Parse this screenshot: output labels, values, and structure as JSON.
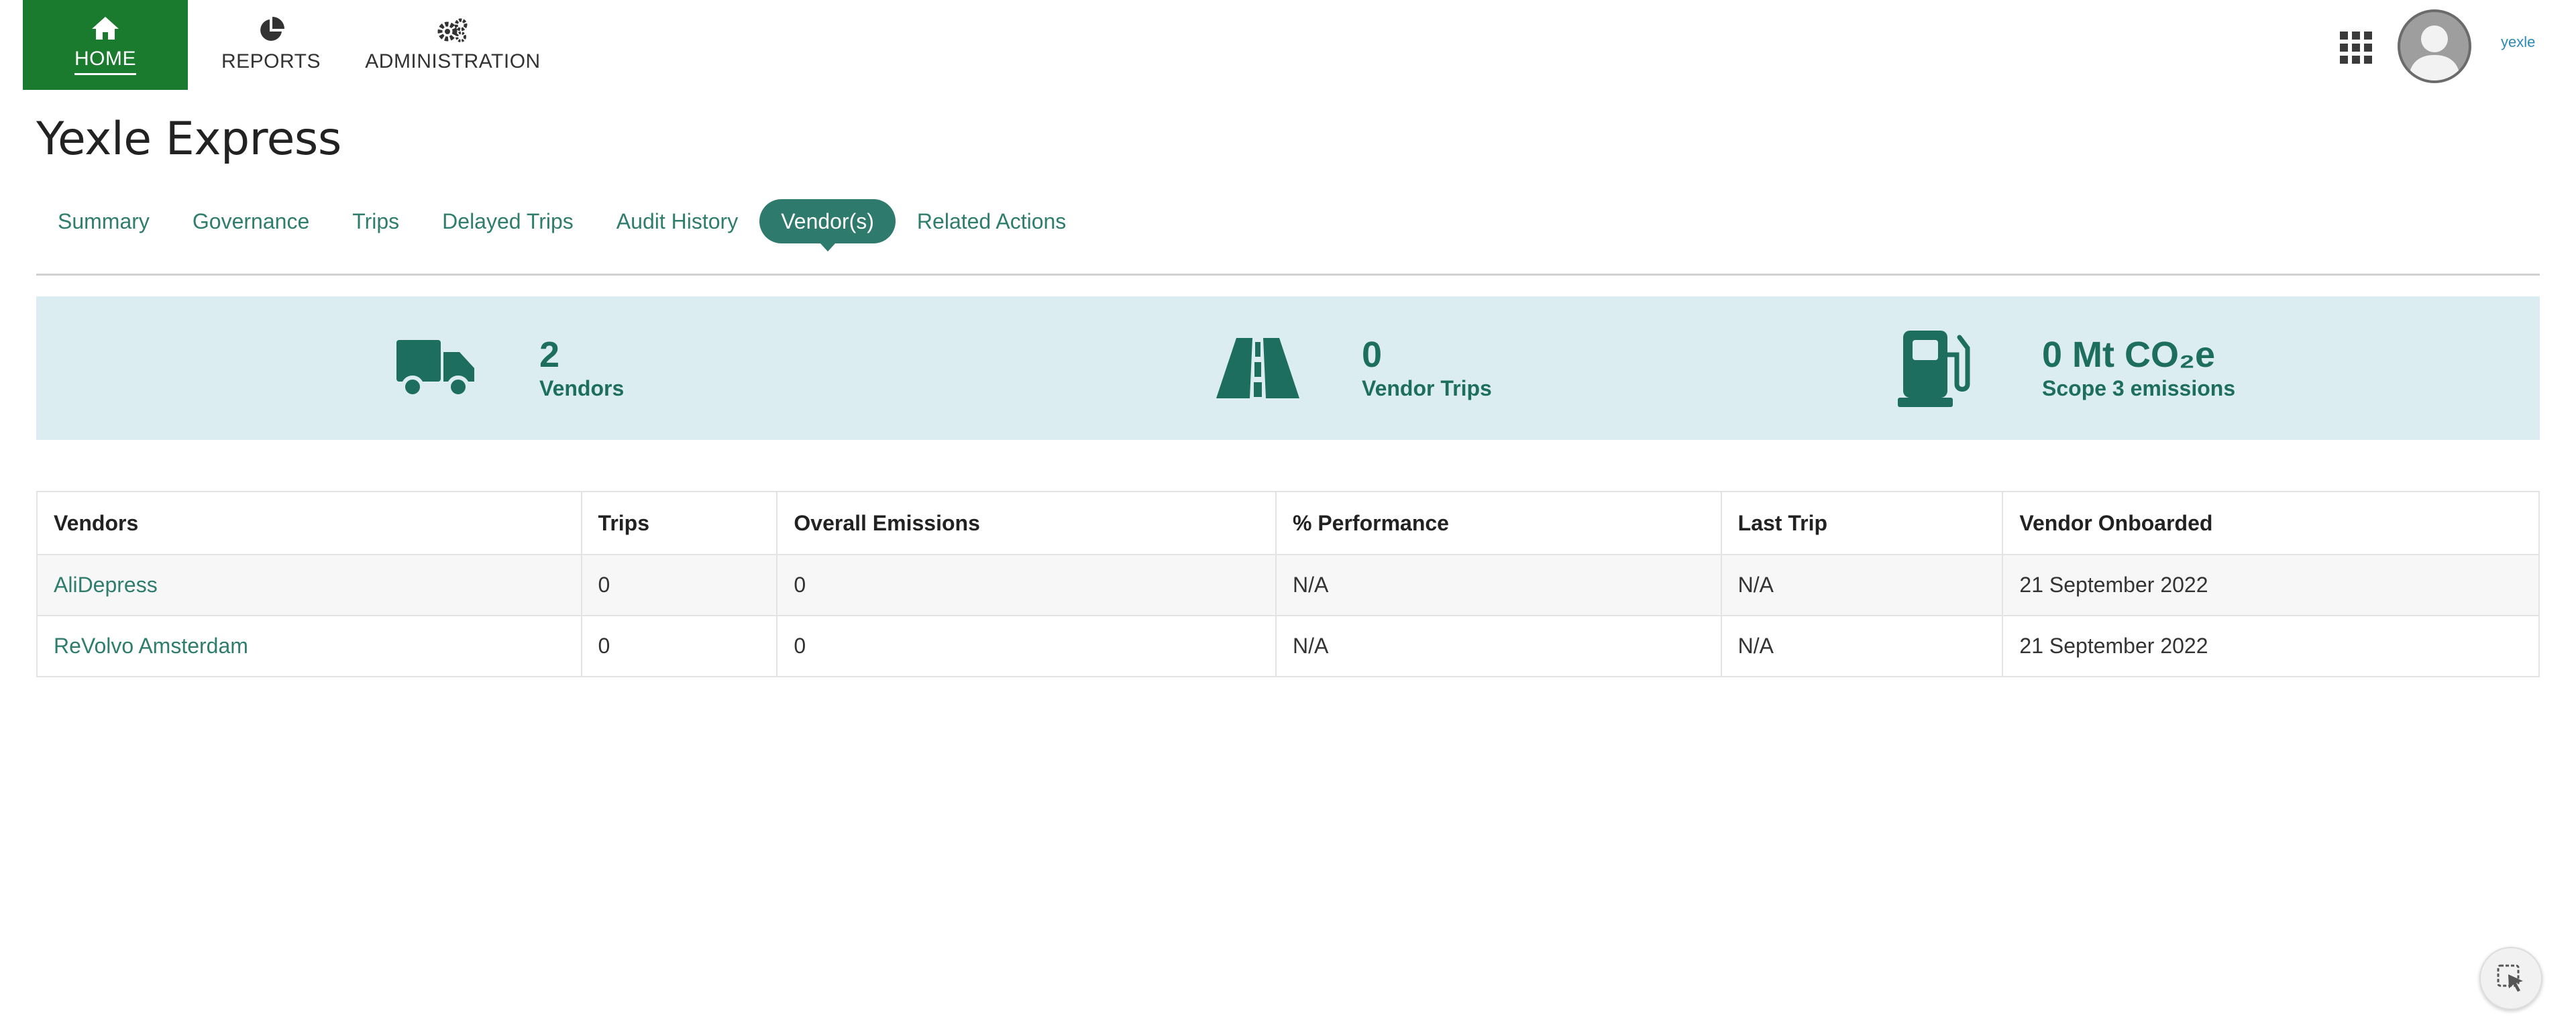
{
  "colors": {
    "nav_active_bg": "#1a7a2e",
    "accent": "#2e7a6c",
    "stats_bg": "#dcedf1",
    "link": "#2e7d6d"
  },
  "topnav": {
    "items": [
      {
        "label": "HOME",
        "icon": "home-icon",
        "active": true
      },
      {
        "label": "REPORTS",
        "icon": "pie-chart-icon",
        "active": false
      },
      {
        "label": "ADMINISTRATION",
        "icon": "gears-icon",
        "active": false
      }
    ],
    "apps_icon": "grid-icon",
    "avatar_icon": "user-avatar-icon",
    "brand_logo_text": "yexle"
  },
  "page": {
    "title": "Yexle Express"
  },
  "tabs": [
    {
      "label": "Summary",
      "active": false
    },
    {
      "label": "Governance",
      "active": false
    },
    {
      "label": "Trips",
      "active": false
    },
    {
      "label": "Delayed Trips",
      "active": false
    },
    {
      "label": "Audit History",
      "active": false
    },
    {
      "label": "Vendor(s)",
      "active": true
    },
    {
      "label": "Related Actions",
      "active": false
    }
  ],
  "stats": {
    "vendors": {
      "value": "2",
      "label": "Vendors",
      "icon": "truck-icon"
    },
    "vendor_trips": {
      "value": "0",
      "label": "Vendor Trips",
      "icon": "road-icon"
    },
    "emissions": {
      "value": "0 Mt CO₂e",
      "label": "Scope 3 emissions",
      "icon": "fuel-pump-icon"
    }
  },
  "table": {
    "headers": [
      "Vendors",
      "Trips",
      "Overall Emissions",
      "% Performance",
      "Last Trip",
      "Vendor Onboarded"
    ],
    "rows": [
      [
        "AliDepress",
        "0",
        "0",
        "N/A",
        "N/A",
        "21 September 2022"
      ],
      [
        "ReVolvo Amsterdam",
        "0",
        "0",
        "N/A",
        "N/A",
        "21 September 2022"
      ]
    ]
  },
  "floating_button": {
    "icon": "cursor-select-icon"
  }
}
